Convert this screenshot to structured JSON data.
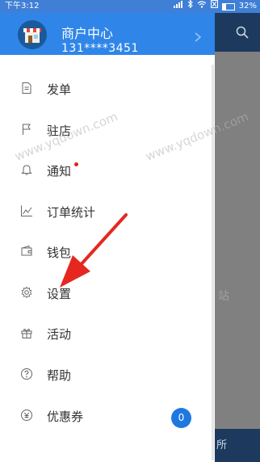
{
  "status_bar": {
    "time": "下午3:12",
    "battery": "32%"
  },
  "drawer_header": {
    "title": "商户中心",
    "phone": "131****3451"
  },
  "menu": [
    {
      "label": "发单",
      "icon": "document-icon"
    },
    {
      "label": "驻店",
      "icon": "flag-icon"
    },
    {
      "label": "通知",
      "icon": "bell-icon",
      "unread_dot": true
    },
    {
      "label": "订单统计",
      "icon": "line-chart-icon"
    },
    {
      "label": "钱包",
      "icon": "wallet-icon"
    },
    {
      "label": "设置",
      "icon": "gear-icon"
    },
    {
      "label": "活动",
      "icon": "gift-icon"
    },
    {
      "label": "帮助",
      "icon": "help-circle-icon"
    },
    {
      "label": "优惠券",
      "icon": "coupon-icon",
      "badge": "0"
    }
  ],
  "watermark": "www.yqdown.com",
  "background_page": {
    "fragment_text": "站",
    "bottom_fragment": "所"
  },
  "colors": {
    "accent": "#2f86e8",
    "dark_bar": "#1d3a5e",
    "badge": "#1f78e0",
    "dot": "#e0241b"
  }
}
